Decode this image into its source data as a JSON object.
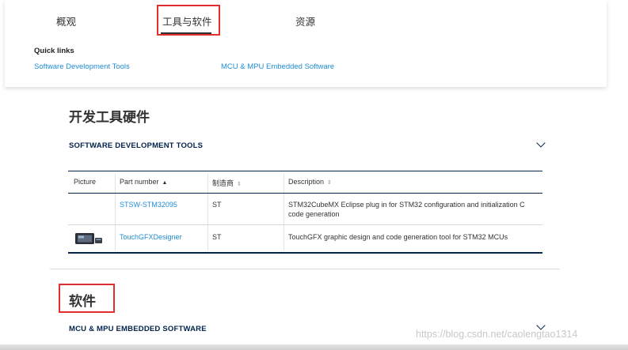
{
  "tabs": {
    "overview": "概观",
    "tools": "工具与软件",
    "resources": "资源"
  },
  "quick_links": {
    "title": "Quick links",
    "items": [
      "Software Development Tools",
      "MCU & MPU Embedded Software"
    ]
  },
  "dev_tools": {
    "heading": "开发工具硬件",
    "subheading": "SOFTWARE DEVELOPMENT TOOLS",
    "table": {
      "headers": {
        "picture": "Picture",
        "part_number": "Part number",
        "manufacturer": "制造商",
        "description": "Description"
      },
      "rows": [
        {
          "part_number": "STSW-STM32095",
          "manufacturer": "ST",
          "description_1": "STM32CubeMX Eclipse plug in for STM32 configuration and initialization C",
          "description_2": "code generation"
        },
        {
          "part_number": "TouchGFXDesigner",
          "manufacturer": "ST",
          "description_1": "TouchGFX graphic design and code generation tool for STM32 MCUs"
        }
      ]
    }
  },
  "software": {
    "heading": "软件",
    "subheading": "MCU & MPU EMBEDDED SOFTWARE"
  },
  "watermark": "https://blog.csdn.net/caolengtao1314",
  "colors": {
    "link": "#1f8dd6",
    "highlight": "#e02f2f",
    "navy": "#03234b"
  }
}
